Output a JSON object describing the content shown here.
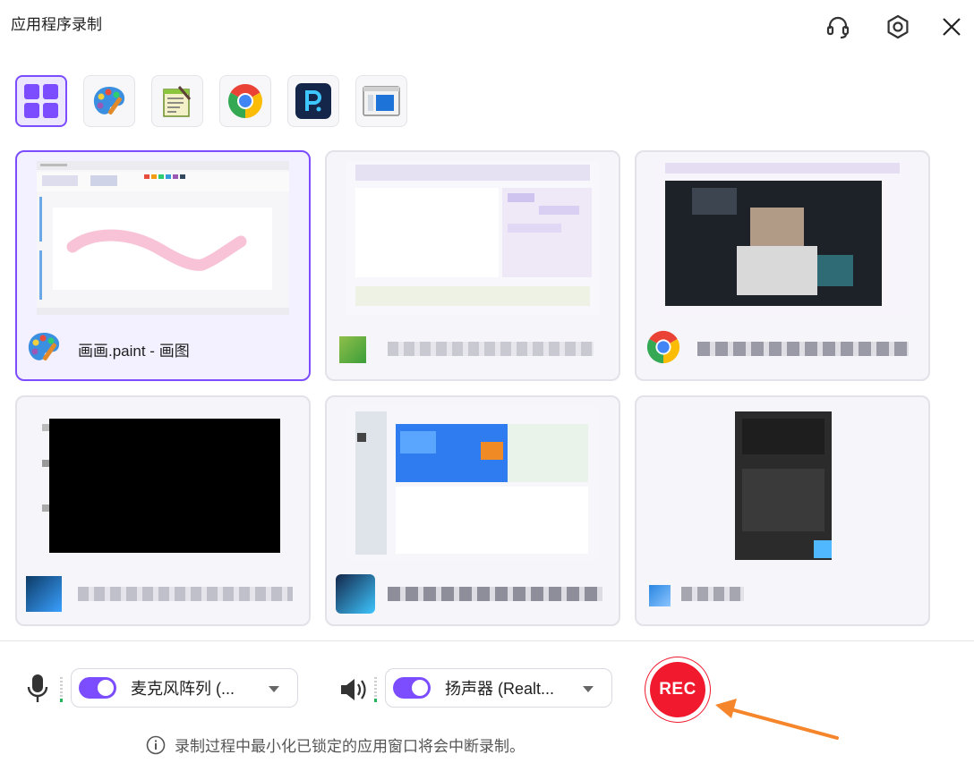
{
  "title": "应用程序录制",
  "header_icons": [
    "headset-icon",
    "gear-icon",
    "close-icon"
  ],
  "app_filters": [
    {
      "name": "all-apps",
      "icon": "grid-icon",
      "active": true
    },
    {
      "name": "paint",
      "icon": "paint-palette-icon"
    },
    {
      "name": "notepad",
      "icon": "notepad-icon"
    },
    {
      "name": "chrome",
      "icon": "chrome-icon"
    },
    {
      "name": "recorder",
      "icon": "p-app-icon"
    },
    {
      "name": "window",
      "icon": "window-icon"
    }
  ],
  "windows": [
    {
      "label": "画画.paint - 画图",
      "selected": true
    }
  ],
  "microphone": {
    "label": "麦克风阵列 (...",
    "enabled": true
  },
  "speaker": {
    "label": "扬声器 (Realt...",
    "enabled": true
  },
  "rec_button": {
    "label": "REC"
  },
  "notice": "录制过程中最小化已锁定的应用窗口将会中断录制。",
  "colors": {
    "accent": "#7b4dff",
    "rec": "#f0192e",
    "arrow": "#f5862b"
  }
}
